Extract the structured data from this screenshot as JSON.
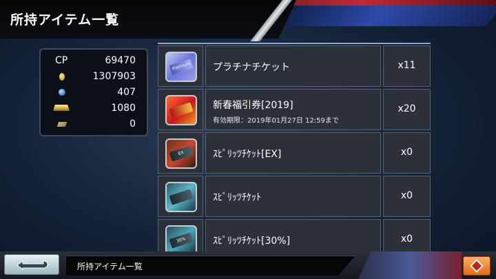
{
  "header": {
    "title": "所持アイテム一覧"
  },
  "stats": {
    "cp_label": "CP",
    "cp_value": "69470",
    "coin_value": "1307903",
    "gem_value": "407",
    "bar_value": "1080",
    "ticket_value": "0"
  },
  "items": [
    {
      "name": "プラチナチケット",
      "sub": "",
      "qty": "x11",
      "icon": "platinum-ticket-icon",
      "tag": "Platinum"
    },
    {
      "name": "新春福引券[2019]",
      "sub": "有効期限：2019年01月27日 12:59まで",
      "qty": "x20",
      "icon": "new-year-lottery-ticket-icon",
      "tag": ""
    },
    {
      "name": "ｽﾋﾟﾘｯﾂﾁｹｯﾄ[EX]",
      "sub": "",
      "qty": "x0",
      "icon": "spirits-ticket-ex-icon",
      "tag": "EX"
    },
    {
      "name": "ｽﾋﾟﾘｯﾂﾁｹｯﾄ",
      "sub": "",
      "qty": "x0",
      "icon": "spirits-ticket-icon",
      "tag": ""
    },
    {
      "name": "ｽﾋﾟﾘｯﾂﾁｹｯﾄ[30%]",
      "sub": "",
      "qty": "x0",
      "icon": "spirits-ticket-30-icon",
      "tag": "30%"
    }
  ],
  "footer": {
    "label": "所持アイテム一覧"
  },
  "colors": {
    "accent_orange": "#e86a10",
    "panel_bg": "#2c3038",
    "header_red": "#c02a35",
    "header_blue": "#2c4aa8"
  }
}
